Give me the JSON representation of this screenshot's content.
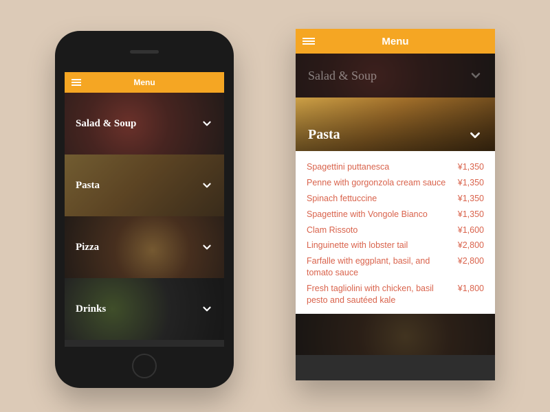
{
  "colors": {
    "accent": "#f5a623",
    "menu_text": "#d9634c",
    "background": "#dccab7"
  },
  "header": {
    "title": "Menu"
  },
  "categories": [
    {
      "label": "Salad & Soup"
    },
    {
      "label": "Pasta"
    },
    {
      "label": "Pizza"
    },
    {
      "label": "Drinks"
    }
  ],
  "expanded": {
    "above_label": "Salad & Soup",
    "active_label": "Pasta",
    "currency": "¥",
    "items": [
      {
        "name": "Spagettini puttanesca",
        "price": "¥1,350"
      },
      {
        "name": "Penne with gorgonzola cream sauce",
        "price": "¥1,350"
      },
      {
        "name": "Spinach fettuccine",
        "price": "¥1,350"
      },
      {
        "name": "Spagettine with Vongole Bianco",
        "price": "¥1,350"
      },
      {
        "name": "Clam Rissoto",
        "price": "¥1,600"
      },
      {
        "name": "Linguinette with lobster tail",
        "price": "¥2,800"
      },
      {
        "name": "Farfalle with eggplant, basil, and tomato sauce",
        "price": "¥2,800"
      },
      {
        "name": "Fresh tagliolini with chicken, basil pesto and sautéed kale",
        "price": "¥1,800"
      }
    ]
  }
}
